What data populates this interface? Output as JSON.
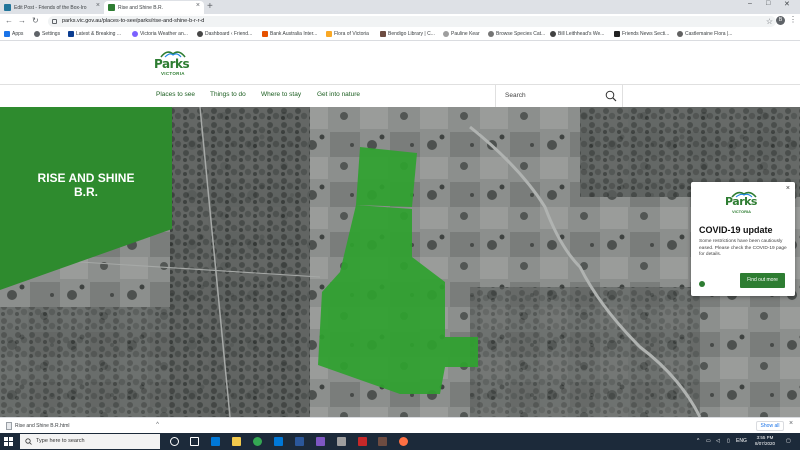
{
  "browser": {
    "tabs": [
      {
        "label": "Edit Post - Friends of the Box-Iro",
        "favicon_color": "#21759b",
        "active": false
      },
      {
        "label": "Rise and Shine B.R.",
        "favicon_color": "#2e7d32",
        "active": true
      }
    ],
    "new_tab": "+",
    "url": "parks.vic.gov.au/places-to-see/parks/rise-and-shine-b-r-r-d",
    "profile_initial": "B",
    "bookmarks": [
      {
        "label": "Apps",
        "icon": "apps-grid-icon"
      },
      {
        "label": "Settings",
        "icon": "gear-icon"
      },
      {
        "label": "Latest & Breaking ...",
        "icon": "news-icon"
      },
      {
        "label": "Victoria Weather an...",
        "icon": "weather-icon"
      },
      {
        "label": "Dashboard ‹ Friend...",
        "icon": "wordpress-icon"
      },
      {
        "label": "Bank Australia Inter...",
        "icon": "bank-icon"
      },
      {
        "label": "Flora of Victoria",
        "icon": "flora-icon"
      },
      {
        "label": "Bendigo Library | C...",
        "icon": "library-icon"
      },
      {
        "label": "Pauline Kear",
        "icon": "person-icon"
      },
      {
        "label": "Browse Species Cat...",
        "icon": "species-icon"
      },
      {
        "label": "Bill Leithhead's We...",
        "icon": "web-icon"
      },
      {
        "label": "Friends News Secti...",
        "icon": "news-icon"
      },
      {
        "label": "Castlemaine Flora |...",
        "icon": "flora-icon"
      }
    ]
  },
  "site": {
    "logo_word": "Parks",
    "logo_sub": "VICTORIA",
    "menu": [
      "Places to see",
      "Things to do",
      "Where to stay",
      "Get into nature"
    ],
    "search_label": "Search"
  },
  "hero": {
    "title_line1": "RISE AND SHINE",
    "title_line2": "B.R.",
    "accent": "#2e8b2e"
  },
  "covid": {
    "logo_word": "Parks",
    "logo_sub": "VICTORIA",
    "heading": "COVID-19 update",
    "body": "Some restrictions have been cautiously eased. Please check the COVID-19 page for details.",
    "button": "Find out more",
    "close": "×"
  },
  "downloads": {
    "file": "Rise and Shine B.R.html",
    "show_all": "Show all",
    "close": "×"
  },
  "taskbar": {
    "search_placeholder": "Type here to search",
    "lang": "ENG",
    "time": "3:55 PM",
    "date": "8/07/2020"
  }
}
